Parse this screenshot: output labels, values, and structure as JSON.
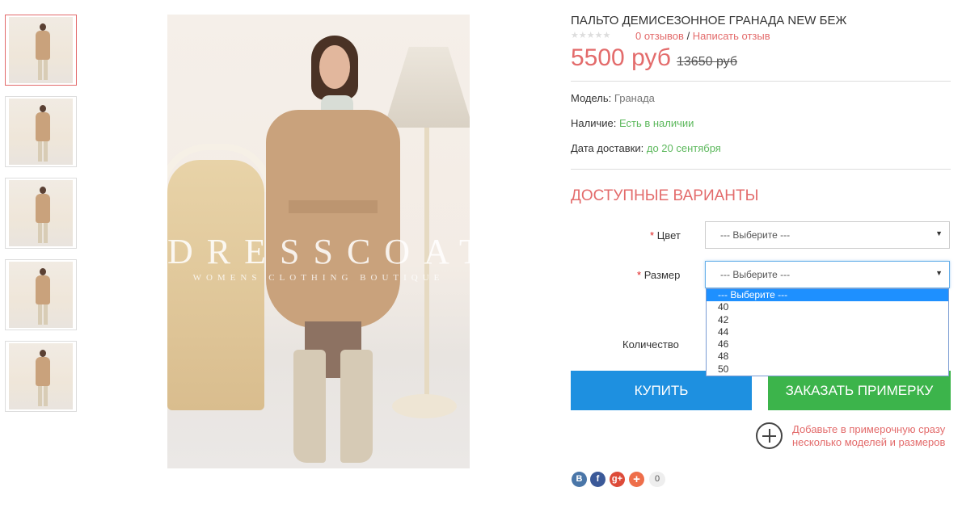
{
  "thumbnails": [
    {
      "name": "thumb-1",
      "active": true
    },
    {
      "name": "thumb-2",
      "active": false
    },
    {
      "name": "thumb-3",
      "active": false
    },
    {
      "name": "thumb-4",
      "active": false
    },
    {
      "name": "thumb-5",
      "active": false
    }
  ],
  "main_image": {
    "watermark": "DRESSCOAT",
    "watermark_sub": "WOMENS CLOTHING BOUTIQUE"
  },
  "product": {
    "title": "ПАЛЬТО ДЕМИСЕЗОННОЕ ГРАНАДА NEW БЕЖ",
    "stars": "★★★★★",
    "reviews_count": "0 отзывов",
    "review_sep": " / ",
    "write_review": "Написать отзыв",
    "price": "5500 руб",
    "old_price": "13650 руб",
    "model_label": "Модель:",
    "model_value": "Гранада",
    "stock_label": "Наличие:",
    "stock_value": "Есть в наличии",
    "delivery_label": "Дата доставки:",
    "delivery_value": "до 20 сентября"
  },
  "options": {
    "title": "ДОСТУПНЫЕ ВАРИАНТЫ",
    "required_mark": "*",
    "color_label": "Цвет",
    "color_value": "--- Выберите ---",
    "size_label": "Размер",
    "size_value": "--- Выберите ---",
    "size_options": [
      "--- Выберите ---",
      "40",
      "42",
      "44",
      "46",
      "48",
      "50"
    ],
    "quantity_label": "Количество"
  },
  "actions": {
    "buy_label": "КУПИТЬ",
    "fitting_label": "ЗАКАЗАТЬ ПРИМЕРКУ",
    "fitting_hint": "Добавьте в примерочную сразу несколько моделей и размеров"
  },
  "share": {
    "vk": "B",
    "fb": "f",
    "gplus": "g+",
    "more": "+",
    "count": "0"
  },
  "colors": {
    "accent_red": "#e36b6b",
    "buy_blue": "#1e90e0",
    "fitting_green": "#3cb44b",
    "in_stock_green": "#5cb85c"
  }
}
